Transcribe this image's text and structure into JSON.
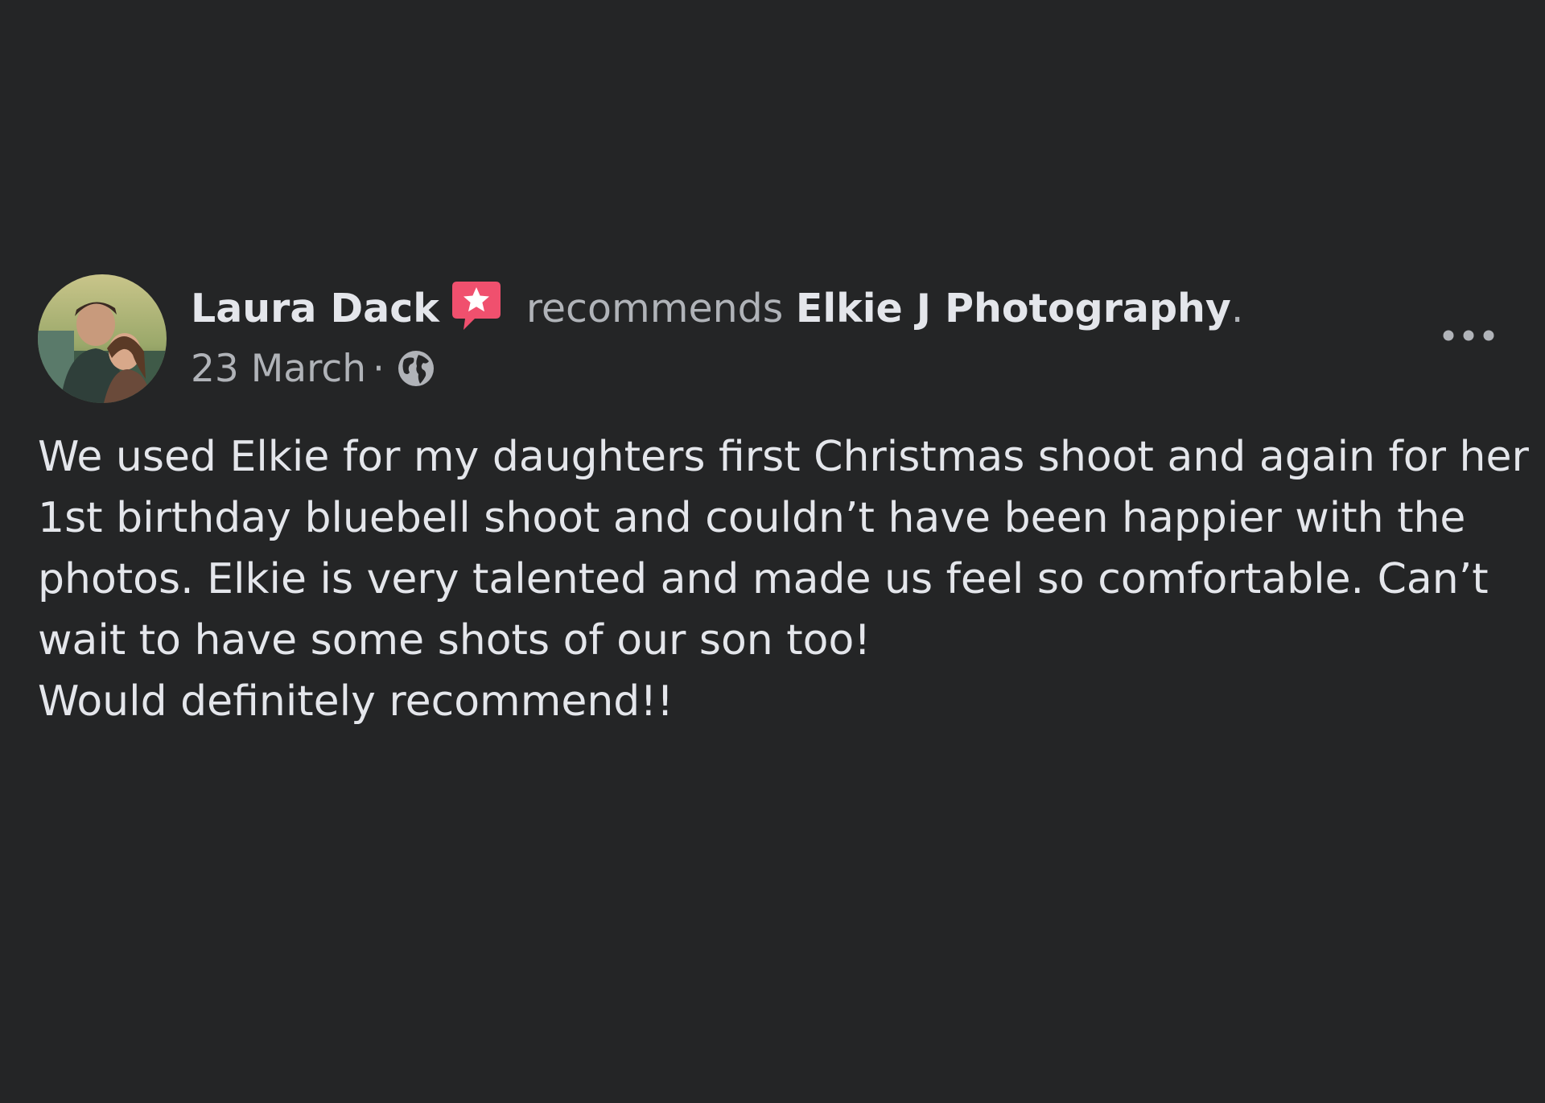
{
  "post": {
    "author_name": "Laura Dack",
    "verb": "recommends",
    "page_name": "Elkie J Photography",
    "period": ".",
    "date": "23 March",
    "separator": "·",
    "privacy_icon": "globe-icon",
    "badge_icon": "top-fan-star-badge-icon",
    "more_icon": "ellipsis-icon",
    "text_lines": [
      "We used Elkie for my daughters first Christmas shoot and again for her",
      "1st birthday bluebell shoot and couldn’t have been happier with the",
      "photos. Elkie is very talented and made us feel so comfortable. Can’t",
      "wait to have some shots of our son too!",
      "Would definitely recommend!!"
    ]
  },
  "colors": {
    "background": "#242526",
    "primary_text": "#e4e6eb",
    "secondary_text": "#b0b3b8",
    "badge": "#f0506e"
  }
}
